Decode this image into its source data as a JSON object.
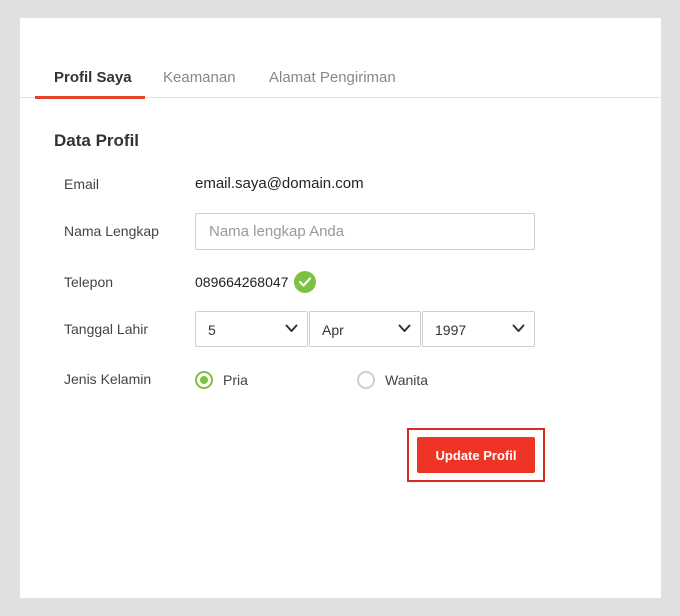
{
  "tabs": [
    {
      "label": "Profil Saya",
      "active": true
    },
    {
      "label": "Keamanan",
      "active": false
    },
    {
      "label": "Alamat Pengiriman",
      "active": false
    }
  ],
  "section_title": "Data Profil",
  "fields": {
    "email": {
      "label": "Email",
      "value": "email.saya@domain.com"
    },
    "name": {
      "label": "Nama Lengkap",
      "value": "",
      "placeholder": "Nama lengkap Anda"
    },
    "phone": {
      "label": "Telepon",
      "value": "089664268047",
      "verified_icon": "check-circle-icon"
    },
    "birthdate": {
      "label": "Tanggal Lahir",
      "day": "5",
      "month": "Apr",
      "year": "1997"
    },
    "gender": {
      "label": "Jenis Kelamin",
      "options": [
        "Pria",
        "Wanita"
      ],
      "selected": "Pria"
    }
  },
  "submit_label": "Update Profil",
  "colors": {
    "accent": "#ee3424",
    "highlight_frame": "#d62b1e",
    "success": "#7cc242"
  }
}
